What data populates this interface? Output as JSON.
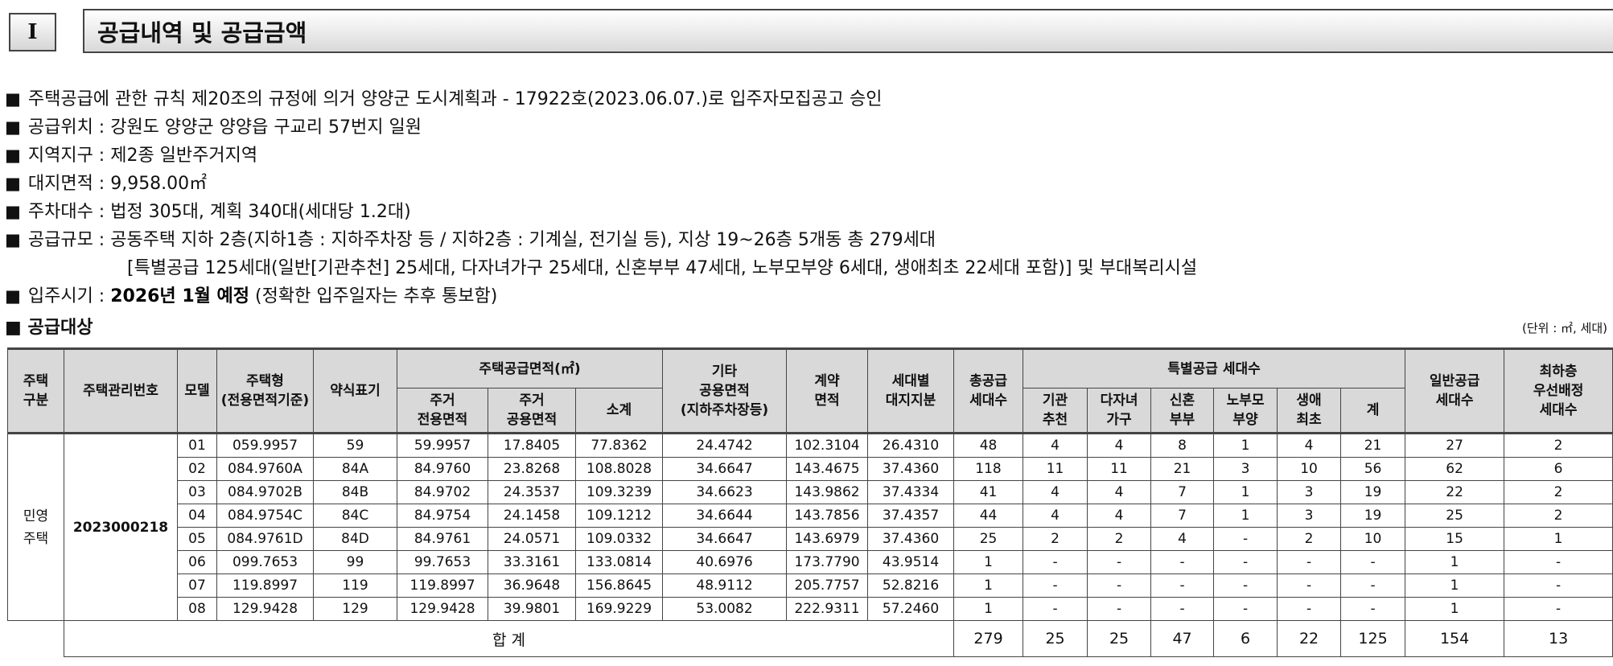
{
  "section": {
    "number": "I",
    "title": "공급내역 및 공급금액"
  },
  "info": {
    "bullet": "■",
    "line1": "주택공급에 관한 규칙 제20조의 규정에 의거 양양군 도시계획과 - 17922호(2023.06.07.)로 입주자모집공고 승인",
    "line2": "공급위치 : 강원도 양양군 양양읍 구교리 57번지 일원",
    "line3": "지역지구 : 제2종 일반주거지역",
    "line4": "대지면적 : 9,958.00㎡",
    "line5": "주차대수 : 법정 305대, 계획 340대(세대당 1.2대)",
    "line6": "공급규모 : 공동주택 지하 2층(지하1층 : 지하주차장 등 / 지하2층 : 기계실, 전기실 등), 지상 19~26층 5개동 총 279세대",
    "line7": "[특별공급 125세대(일반[기관추천] 25세대, 다자녀가구 25세대, 신혼부부 47세대, 노부모부양 6세대, 생애최초 22세대 포함)] 및 부대복리시설",
    "line8_prefix": "입주시기 : ",
    "line8_bold": "2026년 1월 예정",
    "line8_suffix": " (정확한 입주일자는 추후 통보함)",
    "target_title": "공급대상",
    "unit": "(단위 : ㎡, 세대)"
  },
  "table": {
    "headers": {
      "kind": "주택\n구분",
      "mgmt_no": "주택관리번호",
      "model": "모델",
      "type": "주택형\n(전용면적기준)",
      "abbr": "약식표기",
      "supply_area": "주택공급면적(㎡)",
      "exclusive": "주거\n전용면적",
      "common": "주거\n공용면적",
      "subtotal": "소계",
      "other": "기타\n공용면적\n(지하주차장등)",
      "contract": "계약\n면적",
      "land": "세대별\n대지지분",
      "total_units": "총공급\n세대수",
      "special": "특별공급 세대수",
      "sp_inst": "기관\n추천",
      "sp_multi": "다자녀\n가구",
      "sp_newlywed": "신혼\n부부",
      "sp_elderly": "노부모\n부양",
      "sp_first": "생애\n최초",
      "sp_sum": "계",
      "general": "일반공급\n세대수",
      "lowest": "최하층\n우선배정\n세대수"
    },
    "kind": "민영\n주택",
    "mgmt_no": "2023000218",
    "rows": [
      [
        "01",
        "059.9957",
        "59",
        "59.9957",
        "17.8405",
        "77.8362",
        "24.4742",
        "102.3104",
        "26.4310",
        "48",
        "4",
        "4",
        "8",
        "1",
        "4",
        "21",
        "27",
        "2"
      ],
      [
        "02",
        "084.9760A",
        "84A",
        "84.9760",
        "23.8268",
        "108.8028",
        "34.6647",
        "143.4675",
        "37.4360",
        "118",
        "11",
        "11",
        "21",
        "3",
        "10",
        "56",
        "62",
        "6"
      ],
      [
        "03",
        "084.9702B",
        "84B",
        "84.9702",
        "24.3537",
        "109.3239",
        "34.6623",
        "143.9862",
        "37.4334",
        "41",
        "4",
        "4",
        "7",
        "1",
        "3",
        "19",
        "22",
        "2"
      ],
      [
        "04",
        "084.9754C",
        "84C",
        "84.9754",
        "24.1458",
        "109.1212",
        "34.6644",
        "143.7856",
        "37.4357",
        "44",
        "4",
        "4",
        "7",
        "1",
        "3",
        "19",
        "25",
        "2"
      ],
      [
        "05",
        "084.9761D",
        "84D",
        "84.9761",
        "24.0571",
        "109.0332",
        "34.6647",
        "143.6979",
        "37.4360",
        "25",
        "2",
        "2",
        "4",
        "-",
        "2",
        "10",
        "15",
        "1"
      ],
      [
        "06",
        "099.7653",
        "99",
        "99.7653",
        "33.3161",
        "133.0814",
        "40.6976",
        "173.7790",
        "43.9514",
        "1",
        "-",
        "-",
        "-",
        "-",
        "-",
        "-",
        "1",
        "-"
      ],
      [
        "07",
        "119.8997",
        "119",
        "119.8997",
        "36.9648",
        "156.8645",
        "48.9112",
        "205.7757",
        "52.8216",
        "1",
        "-",
        "-",
        "-",
        "-",
        "-",
        "-",
        "1",
        "-"
      ],
      [
        "08",
        "129.9428",
        "129",
        "129.9428",
        "39.9801",
        "169.9229",
        "53.0082",
        "222.9311",
        "57.2460",
        "1",
        "-",
        "-",
        "-",
        "-",
        "-",
        "-",
        "1",
        "-"
      ]
    ],
    "total": {
      "label": "합 계",
      "values": [
        "279",
        "25",
        "25",
        "47",
        "6",
        "22",
        "125",
        "154",
        "13"
      ]
    }
  }
}
